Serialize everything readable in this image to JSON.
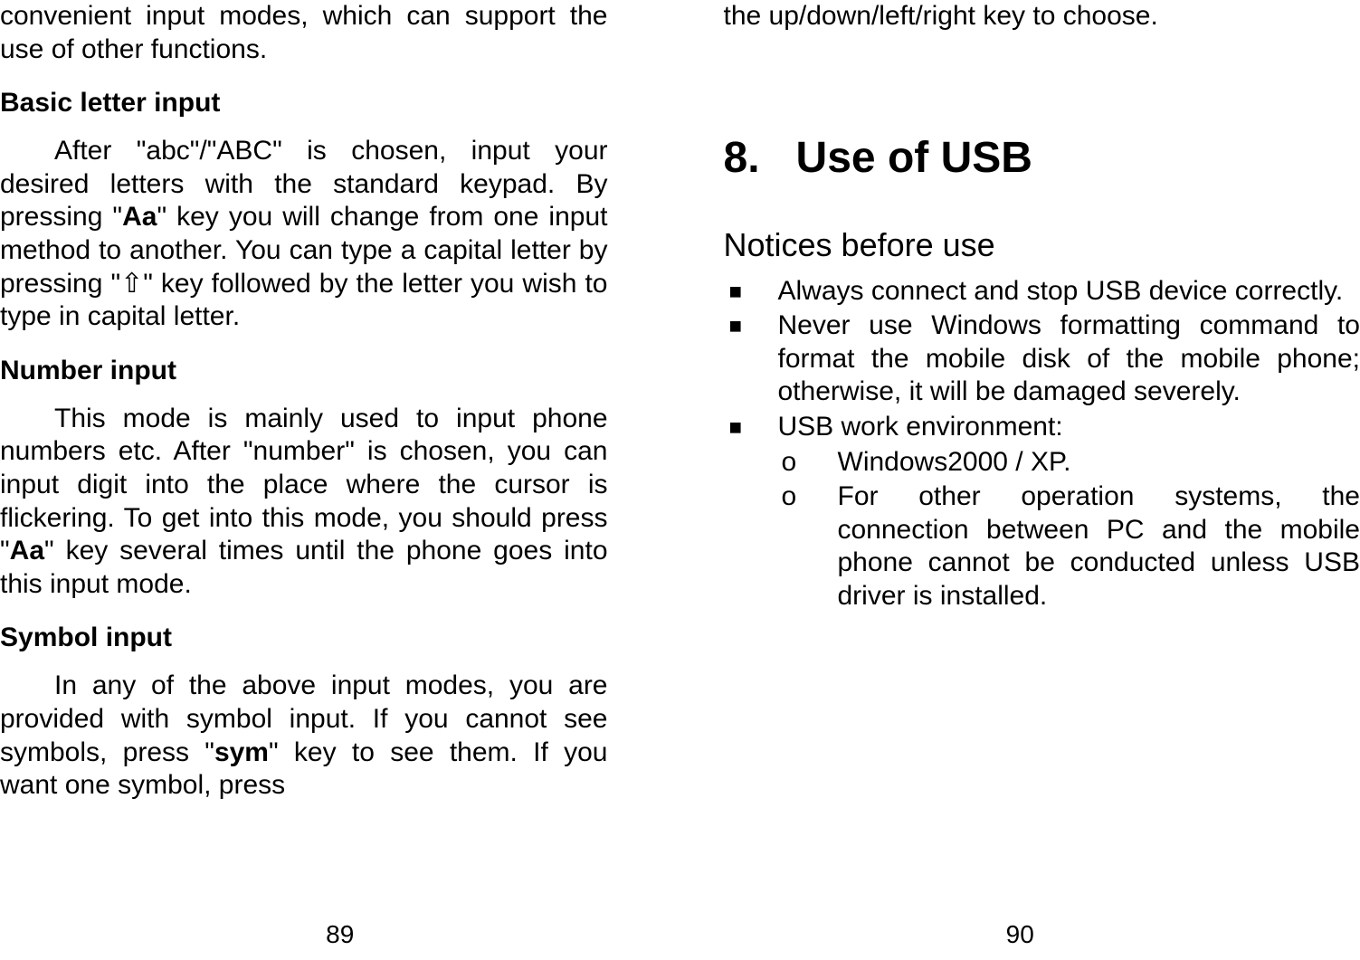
{
  "left_page": {
    "intro_fragment": "convenient input modes, which can support the use of other functions.",
    "sections": {
      "basic_letter": {
        "heading": "Basic letter input",
        "body_parts": [
          "After \"abc\"/\"ABC\" is chosen, input your desired letters with the standard keypad. By pressing \"",
          "Aa",
          "\" key you will change from one input method to another. You can type a capital letter by pressing \"⇧\" key followed by the letter you wish to type in capital letter."
        ]
      },
      "number_input": {
        "heading": "Number input",
        "body_parts": [
          "This mode is mainly used to input phone numbers etc. After \"number\" is chosen, you can input digit into the place where the cursor is flickering. To get into this mode, you should press \"",
          "Aa",
          "\" key several times until the phone goes into this input mode."
        ]
      },
      "symbol_input": {
        "heading": "Symbol input",
        "body_parts": [
          "In any of the above input modes, you are provided with symbol input. If you cannot see symbols, press \"",
          "sym",
          "\" key to see them. If you want one symbol, press"
        ]
      }
    },
    "page_number": "89"
  },
  "right_page": {
    "top_fragment": "the up/down/left/right key to choose.",
    "chapter": {
      "number": "8.",
      "title": "Use of USB"
    },
    "section_heading": "Notices before use",
    "bullets": [
      "Always connect and stop USB device correctly.",
      "Never use Windows formatting command to format the mobile disk of the mobile phone; otherwise, it will be damaged severely.",
      "USB work environment:"
    ],
    "sub_bullets": [
      "Windows2000 / XP.",
      "For other operation systems, the connection between PC and the mobile phone cannot be conducted unless USB driver is installed."
    ],
    "page_number": "90"
  }
}
